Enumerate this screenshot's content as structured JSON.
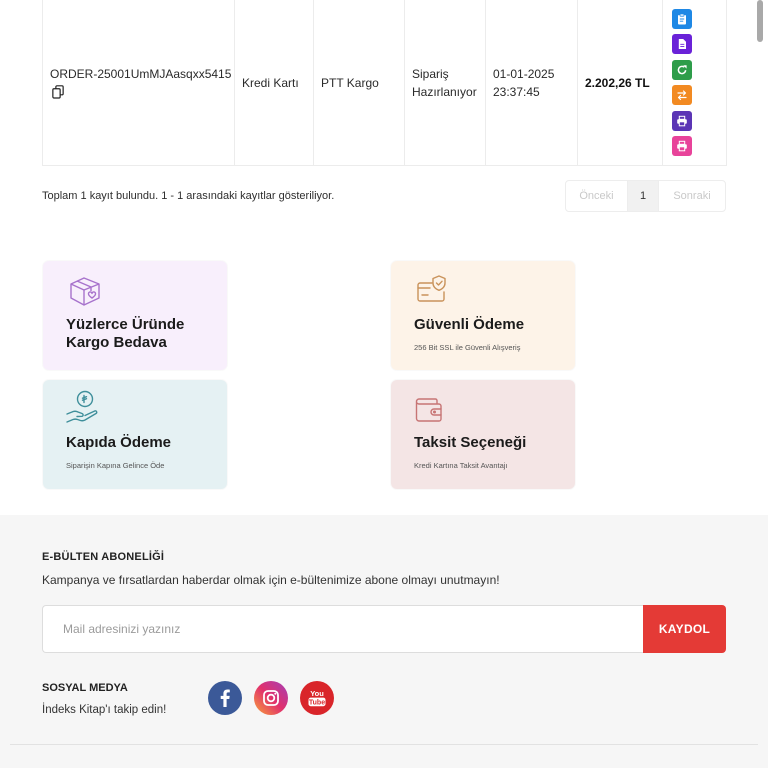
{
  "order_table": {
    "row": {
      "order_id": "ORDER-25001UmMJAasqxx5415",
      "copy_icon": "copy-icon",
      "payment_method": "Kredi Kartı",
      "shipping_company": "PTT Kargo",
      "status": "Sipariş Hazırlanıyor",
      "date": "01-01-2025 23:37:45",
      "total": "2.202,26 TL",
      "actions": [
        {
          "icon": "clipboard-icon",
          "color": "#1e88e5"
        },
        {
          "icon": "document-icon",
          "color": "#6a22d8"
        },
        {
          "icon": "refresh-icon",
          "color": "#2e9d4a"
        },
        {
          "icon": "swap-arrows-icon",
          "color": "#f28a22"
        },
        {
          "icon": "printer-icon",
          "color": "#5b35b5"
        },
        {
          "icon": "printer-icon",
          "color": "#e8439a"
        }
      ]
    }
  },
  "pagination": {
    "summary": "Toplam 1 kayıt bulundu. 1 - 1 arasındaki kayıtlar gösteriliyor.",
    "prev_label": "Önceki",
    "current_page": "1",
    "next_label": "Sonraki"
  },
  "features": [
    {
      "icon": "box-heart-icon",
      "title": "Yüzlerce Üründe Kargo Bedava",
      "bg_color": "#f8effc",
      "icon_color": "#a772cc"
    },
    {
      "icon": "card-shield-icon",
      "title": "Güvenli Ödeme",
      "subtitle": "256 Bit SSL ile Güvenli Alışveriş",
      "bg_color": "#fdf3e8",
      "icon_color": "#c9925a"
    },
    {
      "icon": "hand-coin-icon",
      "title": "Kapıda Ödeme",
      "subtitle": "Siparişin Kapına Gelince Öde",
      "bg_color": "#e5f1f3",
      "icon_color": "#3f8f9b"
    },
    {
      "icon": "wallet-icon",
      "title": "Taksit Seçeneği",
      "subtitle": "Kredi Kartına Taksit Avantajı",
      "bg_color": "#f4e5e5",
      "icon_color": "#c77474"
    }
  ],
  "newsletter": {
    "heading": "E-BÜLTEN ABONELİĞİ",
    "description": "Kampanya ve fırsatlardan haberdar olmak için e-bültenimize abone olmayı unutmayın!",
    "input_placeholder": "Mail adresinizi yazınız",
    "submit_label": "KAYDOL",
    "submit_color": "#e43a36"
  },
  "social": {
    "heading": "SOSYAL MEDYA",
    "subtext": "İndeks Kitap'ı takip edin!",
    "links": [
      {
        "icon": "facebook-icon",
        "color": "#3b5998"
      },
      {
        "icon": "instagram-icon",
        "gradient": [
          "#f9a43a",
          "#e1306c",
          "#a43fb8"
        ]
      },
      {
        "icon": "youtube-icon",
        "color": "#d9252a",
        "logo_top": "You",
        "logo_bottom": "Tube"
      }
    ]
  },
  "colors": {
    "page_background": "#ffffff",
    "footer_background": "#f6f6f6",
    "border": "#ececec"
  }
}
